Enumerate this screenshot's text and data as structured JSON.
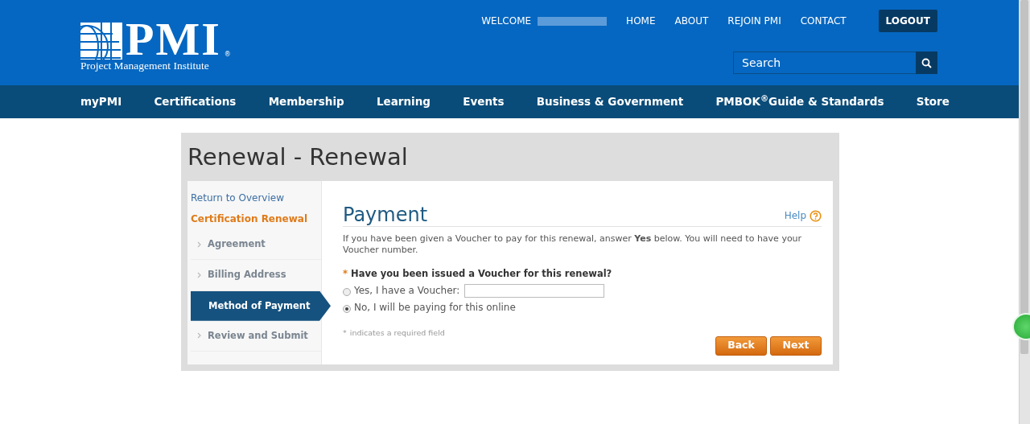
{
  "header": {
    "logo": {
      "letters": "PMI",
      "mark": "®",
      "tagline": "Project Management Institute"
    },
    "welcome": "WELCOME",
    "top_links": [
      "HOME",
      "ABOUT",
      "REJOIN PMI",
      "CONTACT"
    ],
    "logout": "LOGOUT",
    "search": {
      "placeholder": "Search"
    }
  },
  "nav": [
    "myPMI",
    "Certifications",
    "Membership",
    "Learning",
    "Events",
    "Business & Government",
    "PMBOK$^{®}$Guide & Standards",
    "Store"
  ],
  "page_title": "Renewal - Renewal",
  "sidebar": {
    "back_link": "Return to Overview",
    "section": "Certification Renewal",
    "steps": [
      {
        "label": "Agreement",
        "selected": false
      },
      {
        "label": "Billing Address",
        "selected": false
      },
      {
        "label": "Method of Payment",
        "selected": true
      },
      {
        "label": "Review and Submit",
        "selected": false
      }
    ]
  },
  "form": {
    "title": "Payment",
    "help": "Help",
    "intro": "If you have been given a Voucher to pay for this renewal, answer **Yes** below. You will need to have your Voucher number.",
    "question": {
      "required_mark": "*",
      "label": "Have you been issued a Voucher for this renewal?"
    },
    "options": [
      {
        "label": "Yes, I have a Voucher:",
        "selected": false,
        "kind": "with_field"
      },
      {
        "label": "No, I will be paying for this online",
        "selected": true,
        "kind": "plain"
      }
    ],
    "note": {
      "required_mark": "*",
      "text": "indicates a required field"
    },
    "buttons": [
      "Back",
      "Next"
    ]
  }
}
